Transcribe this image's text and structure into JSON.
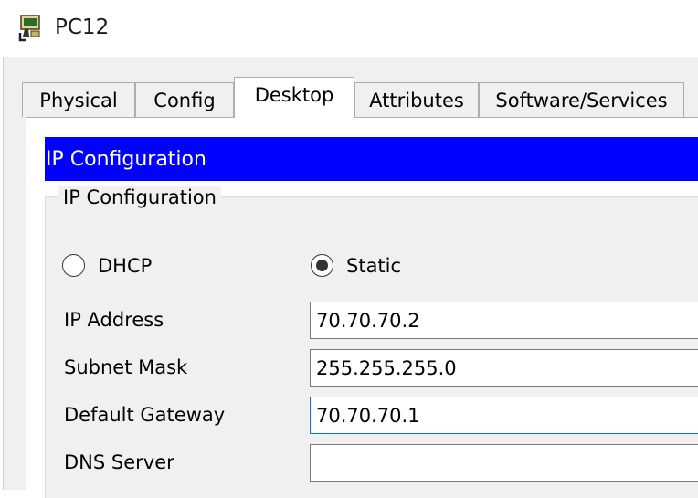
{
  "window": {
    "title": "PC12",
    "icon": "pc-device-icon"
  },
  "tabs": [
    {
      "label": "Physical",
      "selected": false
    },
    {
      "label": "Config",
      "selected": false
    },
    {
      "label": "Desktop",
      "selected": true
    },
    {
      "label": "Attributes",
      "selected": false
    },
    {
      "label": "Software/Services",
      "selected": false
    }
  ],
  "panel": {
    "header": "IP Configuration",
    "group_title": "IP Configuration",
    "mode": {
      "dhcp_label": "DHCP",
      "static_label": "Static",
      "selected": "Static"
    },
    "fields": {
      "ip_address": {
        "label": "IP Address",
        "value": "70.70.70.2"
      },
      "subnet_mask": {
        "label": "Subnet Mask",
        "value": "255.255.255.0"
      },
      "default_gateway": {
        "label": "Default Gateway",
        "value": "70.70.70.1"
      },
      "dns_server": {
        "label": "DNS Server",
        "value": ""
      }
    }
  },
  "colors": {
    "header_bg": "#0000ff",
    "header_text": "#ffffff",
    "focus_border": "#0078d7"
  }
}
